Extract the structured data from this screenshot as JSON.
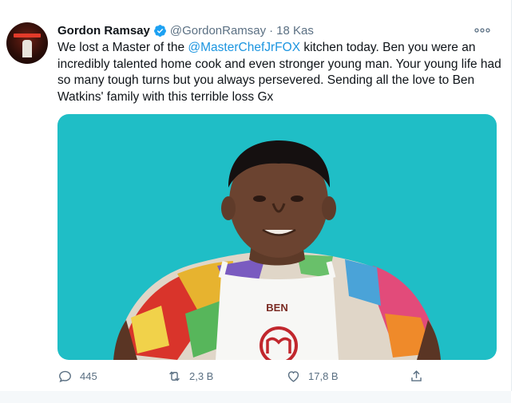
{
  "tweet": {
    "author_name": "Gordon Ramsay",
    "author_handle": "@GordonRamsay",
    "separator": "·",
    "date": "18 Kas",
    "text_before": "We lost a Master of the ",
    "mention": "@MasterChefJrFOX",
    "text_after": " kitchen today. Ben you were an incredibly talented home cook and even stronger young man. Your young life had so many tough turns but you always persevered. Sending all the love to Ben Watkins' family with this terrible loss Gx",
    "media": {
      "apron_label": "BEN",
      "background_color": "#1fbec6"
    },
    "actions": {
      "reply_count": "445",
      "retweet_count": "2,3 B",
      "like_count": "17,8 B"
    },
    "icons": [
      "verified-badge-icon",
      "more-options-icon",
      "reply-icon",
      "retweet-icon",
      "like-icon",
      "share-icon"
    ],
    "colors": {
      "accent": "#1b95e0",
      "muted": "#5b7083"
    }
  }
}
